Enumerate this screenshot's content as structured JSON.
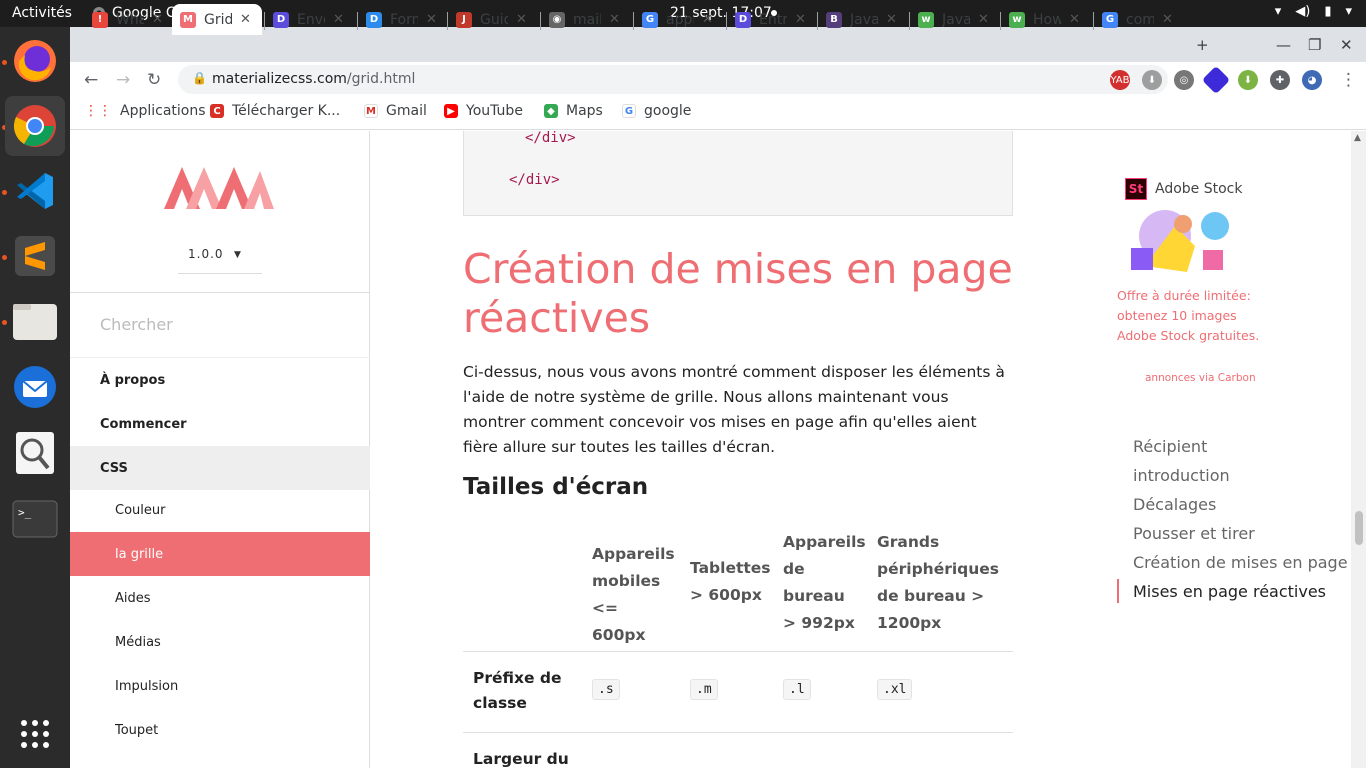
{
  "os": {
    "activities": "Activités",
    "app_name": "Google Chrome",
    "clock": "21 sept.  17:07"
  },
  "dock": {
    "items": [
      "firefox-icon",
      "chrome-icon",
      "vscode-icon",
      "sublime-icon",
      "files-icon",
      "thunderbird-icon",
      "magnifier-icon",
      "terminal-icon",
      "apps-grid-icon"
    ]
  },
  "tabs": [
    {
      "title": "Wha",
      "icon": "!",
      "color": "#e8453c"
    },
    {
      "title": "Grid",
      "icon": "M",
      "color": "#ee6e73"
    },
    {
      "title": "Envo",
      "icon": "D",
      "color": "#5b4cdb"
    },
    {
      "title": "Form",
      "icon": "D",
      "color": "#2d8ceb"
    },
    {
      "title": "Guid",
      "icon": "J",
      "color": "#c0392b"
    },
    {
      "title": "mail",
      "icon": "◉",
      "color": "#666"
    },
    {
      "title": "appl",
      "icon": "G",
      "color": "#4285f4"
    },
    {
      "title": "Entr",
      "icon": "D",
      "color": "#5b4cdb"
    },
    {
      "title": "Java",
      "icon": "B",
      "color": "#563d7c"
    },
    {
      "title": "Java",
      "icon": "w",
      "color": "#4caf50"
    },
    {
      "title": "How",
      "icon": "w",
      "color": "#4caf50"
    },
    {
      "title": "com",
      "icon": "G",
      "color": "#4285f4"
    }
  ],
  "address": {
    "domain": "materializecss.com",
    "path": "/grid.html"
  },
  "bookmarks": [
    {
      "label": "Applications"
    },
    {
      "label": "Télécharger K..."
    },
    {
      "label": "Gmail"
    },
    {
      "label": "YouTube"
    },
    {
      "label": "Maps"
    },
    {
      "label": "google"
    }
  ],
  "sidebar": {
    "version": "1.0.0",
    "search_placeholder": "Chercher",
    "items": [
      {
        "label": "À propos"
      },
      {
        "label": "Commencer"
      },
      {
        "label": "CSS"
      },
      {
        "label": "Couleur"
      },
      {
        "label": "la grille"
      },
      {
        "label": "Aides"
      },
      {
        "label": "Médias"
      },
      {
        "label": "Impulsion"
      },
      {
        "label": "Toupet"
      }
    ]
  },
  "content": {
    "code_line1": "</div>",
    "code_line2": "</div>",
    "heading": "Création de mises en page réactives",
    "intro": "Ci-dessus, nous vous avons montré comment disposer les éléments à l'aide de notre système de grille. Nous allons maintenant vous montrer comment concevoir vos mises en page afin qu'elles aient fière allure sur toutes les tailles d'écran.",
    "subheading": "Tailles d'écran",
    "table": {
      "headers": [
        "Appareils mobiles <= 600px",
        "Tablettes > 600px",
        "Appareils de bureau > 992px",
        "Grands périphériques de bureau > 1200px"
      ],
      "row1_label": "Préfixe de classe",
      "row1_values": [
        ".s",
        ".m",
        ".l",
        ".xl"
      ],
      "row2_label": "Largeur du"
    }
  },
  "ad": {
    "brand": "Adobe Stock",
    "text": "Offre à durée limitée: obtenez 10 images Adobe Stock gratuites.",
    "via": "annonces via Carbon"
  },
  "toc": {
    "items": [
      "Récipient",
      "introduction",
      "Décalages",
      "Pousser et tirer",
      "Création de mises en page",
      "Mises en page réactives"
    ]
  }
}
